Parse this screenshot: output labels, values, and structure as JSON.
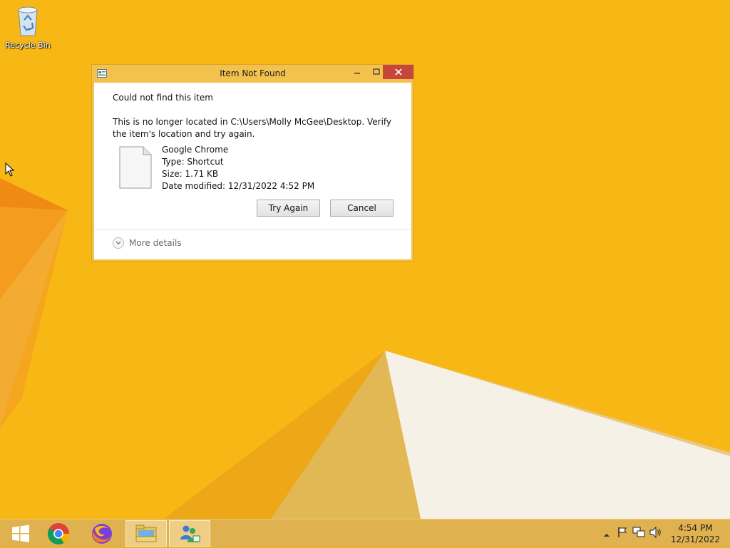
{
  "desktop": {
    "icons": [
      {
        "label": "Recycle Bin",
        "icon": "recycle-bin-icon"
      }
    ]
  },
  "dialog": {
    "title": "Item Not Found",
    "heading": "Could not find this item",
    "message": "This is no longer located in C:\\Users\\Molly McGee\\Desktop. Verify the item's location and try again.",
    "file": {
      "name": "Google Chrome",
      "type": "Type: Shortcut",
      "size": "Size: 1.71 KB",
      "date_modified": "Date modified: 12/31/2022 4:52 PM",
      "icon": "document-icon"
    },
    "buttons": {
      "try_again": "Try Again",
      "cancel": "Cancel"
    },
    "more_details": "More details"
  },
  "taskbar": {
    "items": [
      {
        "name": "start",
        "icon": "windows-logo-icon"
      },
      {
        "name": "chrome",
        "icon": "chrome-icon"
      },
      {
        "name": "firefox",
        "icon": "firefox-icon"
      },
      {
        "name": "file-explorer",
        "icon": "file-explorer-icon",
        "active": true
      },
      {
        "name": "user-app",
        "icon": "users-icon",
        "active": true
      }
    ],
    "tray_icons": [
      "chevron-up-icon",
      "flag-icon",
      "network-icon",
      "volume-icon"
    ],
    "clock": {
      "time": "4:54 PM",
      "date": "12/31/2022"
    }
  },
  "colors": {
    "wallpaper": "#f6b40e",
    "dialog_frame": "#f2c24d",
    "close_button": "#c7463a",
    "taskbar": "#e0b14f"
  }
}
